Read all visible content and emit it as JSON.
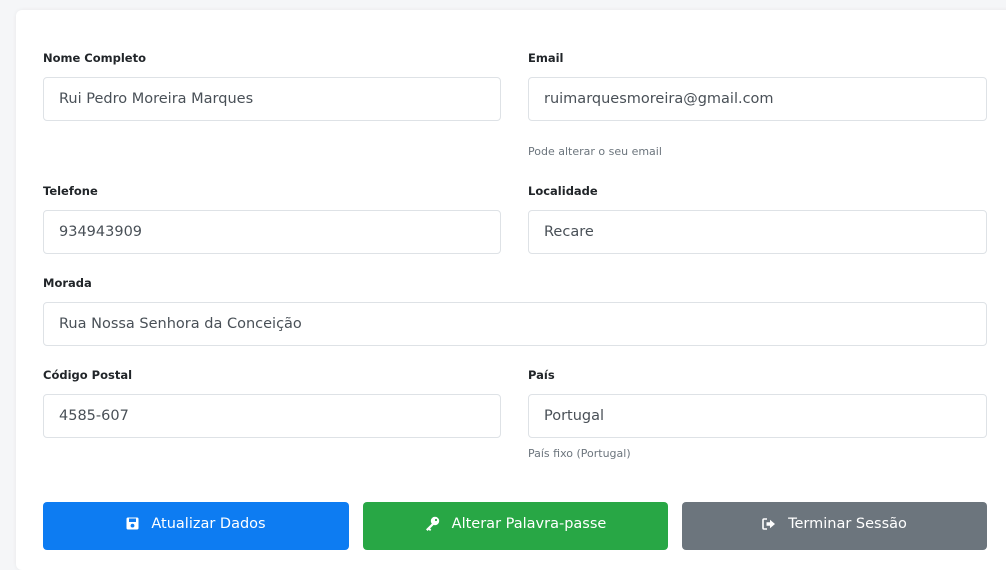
{
  "form": {
    "full_name": {
      "label": "Nome Completo",
      "value": "Rui Pedro Moreira Marques"
    },
    "email": {
      "label": "Email",
      "value": "ruimarquesmoreira@gmail.com",
      "help": "Pode alterar o seu email"
    },
    "phone": {
      "label": "Telefone",
      "value": "934943909"
    },
    "locality": {
      "label": "Localidade",
      "value": "Recare"
    },
    "address": {
      "label": "Morada",
      "value": "Rua Nossa Senhora da Conceição"
    },
    "postal_code": {
      "label": "Código Postal",
      "value": "4585-607"
    },
    "country": {
      "label": "País",
      "value": "Portugal",
      "help": "País fixo (Portugal)"
    }
  },
  "actions": {
    "update": {
      "label": "Atualizar Dados",
      "icon": "save-icon",
      "color": "#0d7cf2"
    },
    "change_password": {
      "label": "Alterar Palavra-passe",
      "icon": "key-icon",
      "color": "#28a745"
    },
    "logout": {
      "label": "Terminar Sessão",
      "icon": "sign-out-icon",
      "color": "#6c757d"
    }
  }
}
